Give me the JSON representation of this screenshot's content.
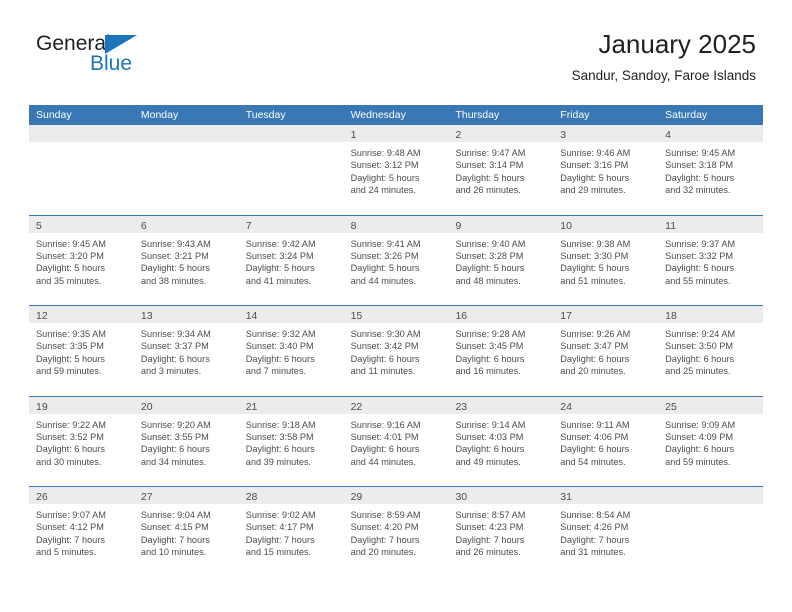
{
  "logo": {
    "text_top": "General",
    "text_bottom": "Blue",
    "icon": "triangle-icon",
    "color_primary": "#1b75bb",
    "color_text": "#231f20"
  },
  "header": {
    "title": "January 2025",
    "subtitle": "Sandur, Sandoy, Faroe Islands"
  },
  "theme": {
    "header_band": "#3a78b5",
    "day_strip": "#ececec",
    "text": "#4d4d4d"
  },
  "calendar": {
    "weekday_headers": [
      "Sunday",
      "Monday",
      "Tuesday",
      "Wednesday",
      "Thursday",
      "Friday",
      "Saturday"
    ],
    "weeks": [
      [
        {
          "day": "",
          "empty": true,
          "sunrise": "",
          "sunset": "",
          "daylight_line1": "",
          "daylight_line2": ""
        },
        {
          "day": "",
          "empty": true,
          "sunrise": "",
          "sunset": "",
          "daylight_line1": "",
          "daylight_line2": ""
        },
        {
          "day": "",
          "empty": true,
          "sunrise": "",
          "sunset": "",
          "daylight_line1": "",
          "daylight_line2": ""
        },
        {
          "day": "1",
          "sunrise": "Sunrise: 9:48 AM",
          "sunset": "Sunset: 3:12 PM",
          "daylight_line1": "Daylight: 5 hours",
          "daylight_line2": "and 24 minutes."
        },
        {
          "day": "2",
          "sunrise": "Sunrise: 9:47 AM",
          "sunset": "Sunset: 3:14 PM",
          "daylight_line1": "Daylight: 5 hours",
          "daylight_line2": "and 26 minutes."
        },
        {
          "day": "3",
          "sunrise": "Sunrise: 9:46 AM",
          "sunset": "Sunset: 3:16 PM",
          "daylight_line1": "Daylight: 5 hours",
          "daylight_line2": "and 29 minutes."
        },
        {
          "day": "4",
          "sunrise": "Sunrise: 9:45 AM",
          "sunset": "Sunset: 3:18 PM",
          "daylight_line1": "Daylight: 5 hours",
          "daylight_line2": "and 32 minutes."
        }
      ],
      [
        {
          "day": "5",
          "sunrise": "Sunrise: 9:45 AM",
          "sunset": "Sunset: 3:20 PM",
          "daylight_line1": "Daylight: 5 hours",
          "daylight_line2": "and 35 minutes."
        },
        {
          "day": "6",
          "sunrise": "Sunrise: 9:43 AM",
          "sunset": "Sunset: 3:21 PM",
          "daylight_line1": "Daylight: 5 hours",
          "daylight_line2": "and 38 minutes."
        },
        {
          "day": "7",
          "sunrise": "Sunrise: 9:42 AM",
          "sunset": "Sunset: 3:24 PM",
          "daylight_line1": "Daylight: 5 hours",
          "daylight_line2": "and 41 minutes."
        },
        {
          "day": "8",
          "sunrise": "Sunrise: 9:41 AM",
          "sunset": "Sunset: 3:26 PM",
          "daylight_line1": "Daylight: 5 hours",
          "daylight_line2": "and 44 minutes."
        },
        {
          "day": "9",
          "sunrise": "Sunrise: 9:40 AM",
          "sunset": "Sunset: 3:28 PM",
          "daylight_line1": "Daylight: 5 hours",
          "daylight_line2": "and 48 minutes."
        },
        {
          "day": "10",
          "sunrise": "Sunrise: 9:38 AM",
          "sunset": "Sunset: 3:30 PM",
          "daylight_line1": "Daylight: 5 hours",
          "daylight_line2": "and 51 minutes."
        },
        {
          "day": "11",
          "sunrise": "Sunrise: 9:37 AM",
          "sunset": "Sunset: 3:32 PM",
          "daylight_line1": "Daylight: 5 hours",
          "daylight_line2": "and 55 minutes."
        }
      ],
      [
        {
          "day": "12",
          "sunrise": "Sunrise: 9:35 AM",
          "sunset": "Sunset: 3:35 PM",
          "daylight_line1": "Daylight: 5 hours",
          "daylight_line2": "and 59 minutes."
        },
        {
          "day": "13",
          "sunrise": "Sunrise: 9:34 AM",
          "sunset": "Sunset: 3:37 PM",
          "daylight_line1": "Daylight: 6 hours",
          "daylight_line2": "and 3 minutes."
        },
        {
          "day": "14",
          "sunrise": "Sunrise: 9:32 AM",
          "sunset": "Sunset: 3:40 PM",
          "daylight_line1": "Daylight: 6 hours",
          "daylight_line2": "and 7 minutes."
        },
        {
          "day": "15",
          "sunrise": "Sunrise: 9:30 AM",
          "sunset": "Sunset: 3:42 PM",
          "daylight_line1": "Daylight: 6 hours",
          "daylight_line2": "and 11 minutes."
        },
        {
          "day": "16",
          "sunrise": "Sunrise: 9:28 AM",
          "sunset": "Sunset: 3:45 PM",
          "daylight_line1": "Daylight: 6 hours",
          "daylight_line2": "and 16 minutes."
        },
        {
          "day": "17",
          "sunrise": "Sunrise: 9:26 AM",
          "sunset": "Sunset: 3:47 PM",
          "daylight_line1": "Daylight: 6 hours",
          "daylight_line2": "and 20 minutes."
        },
        {
          "day": "18",
          "sunrise": "Sunrise: 9:24 AM",
          "sunset": "Sunset: 3:50 PM",
          "daylight_line1": "Daylight: 6 hours",
          "daylight_line2": "and 25 minutes."
        }
      ],
      [
        {
          "day": "19",
          "sunrise": "Sunrise: 9:22 AM",
          "sunset": "Sunset: 3:52 PM",
          "daylight_line1": "Daylight: 6 hours",
          "daylight_line2": "and 30 minutes."
        },
        {
          "day": "20",
          "sunrise": "Sunrise: 9:20 AM",
          "sunset": "Sunset: 3:55 PM",
          "daylight_line1": "Daylight: 6 hours",
          "daylight_line2": "and 34 minutes."
        },
        {
          "day": "21",
          "sunrise": "Sunrise: 9:18 AM",
          "sunset": "Sunset: 3:58 PM",
          "daylight_line1": "Daylight: 6 hours",
          "daylight_line2": "and 39 minutes."
        },
        {
          "day": "22",
          "sunrise": "Sunrise: 9:16 AM",
          "sunset": "Sunset: 4:01 PM",
          "daylight_line1": "Daylight: 6 hours",
          "daylight_line2": "and 44 minutes."
        },
        {
          "day": "23",
          "sunrise": "Sunrise: 9:14 AM",
          "sunset": "Sunset: 4:03 PM",
          "daylight_line1": "Daylight: 6 hours",
          "daylight_line2": "and 49 minutes."
        },
        {
          "day": "24",
          "sunrise": "Sunrise: 9:11 AM",
          "sunset": "Sunset: 4:06 PM",
          "daylight_line1": "Daylight: 6 hours",
          "daylight_line2": "and 54 minutes."
        },
        {
          "day": "25",
          "sunrise": "Sunrise: 9:09 AM",
          "sunset": "Sunset: 4:09 PM",
          "daylight_line1": "Daylight: 6 hours",
          "daylight_line2": "and 59 minutes."
        }
      ],
      [
        {
          "day": "26",
          "sunrise": "Sunrise: 9:07 AM",
          "sunset": "Sunset: 4:12 PM",
          "daylight_line1": "Daylight: 7 hours",
          "daylight_line2": "and 5 minutes."
        },
        {
          "day": "27",
          "sunrise": "Sunrise: 9:04 AM",
          "sunset": "Sunset: 4:15 PM",
          "daylight_line1": "Daylight: 7 hours",
          "daylight_line2": "and 10 minutes."
        },
        {
          "day": "28",
          "sunrise": "Sunrise: 9:02 AM",
          "sunset": "Sunset: 4:17 PM",
          "daylight_line1": "Daylight: 7 hours",
          "daylight_line2": "and 15 minutes."
        },
        {
          "day": "29",
          "sunrise": "Sunrise: 8:59 AM",
          "sunset": "Sunset: 4:20 PM",
          "daylight_line1": "Daylight: 7 hours",
          "daylight_line2": "and 20 minutes."
        },
        {
          "day": "30",
          "sunrise": "Sunrise: 8:57 AM",
          "sunset": "Sunset: 4:23 PM",
          "daylight_line1": "Daylight: 7 hours",
          "daylight_line2": "and 26 minutes."
        },
        {
          "day": "31",
          "sunrise": "Sunrise: 8:54 AM",
          "sunset": "Sunset: 4:26 PM",
          "daylight_line1": "Daylight: 7 hours",
          "daylight_line2": "and 31 minutes."
        },
        {
          "day": "",
          "empty": true,
          "sunrise": "",
          "sunset": "",
          "daylight_line1": "",
          "daylight_line2": ""
        }
      ]
    ]
  }
}
